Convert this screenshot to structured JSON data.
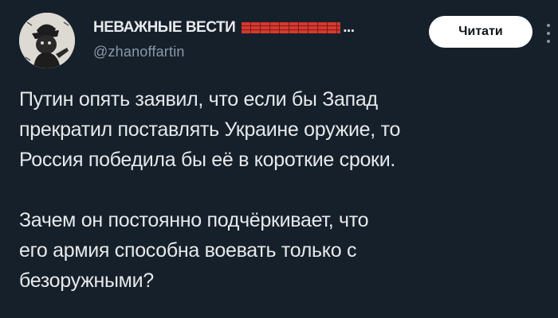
{
  "author": {
    "name": "НЕВАЖНЫЕ ВЕСТИ",
    "name_suffix": "...",
    "handle": "@zhanoffartin"
  },
  "actions": {
    "follow_label": "Читати"
  },
  "icons": {
    "avatar": "avatar-illustration",
    "flag": "brick-wall-flag-icon",
    "more": "more-options-icon"
  },
  "colors": {
    "background": "#15202b",
    "text": "#e7e9ea",
    "secondary_text": "#8b98a5",
    "button_bg": "#ffffff",
    "button_text": "#0f1419",
    "flag": "#d6392f"
  },
  "tweet": {
    "paragraphs": [
      "Путин опять заявил, что если бы Запад\nпрекратил поставлять Украине оружие, то\nРоссия победила бы её в короткие сроки.",
      "Зачем он постоянно подчёркивает, что\nего армия способна воевать только с\nбезоружными?"
    ]
  }
}
